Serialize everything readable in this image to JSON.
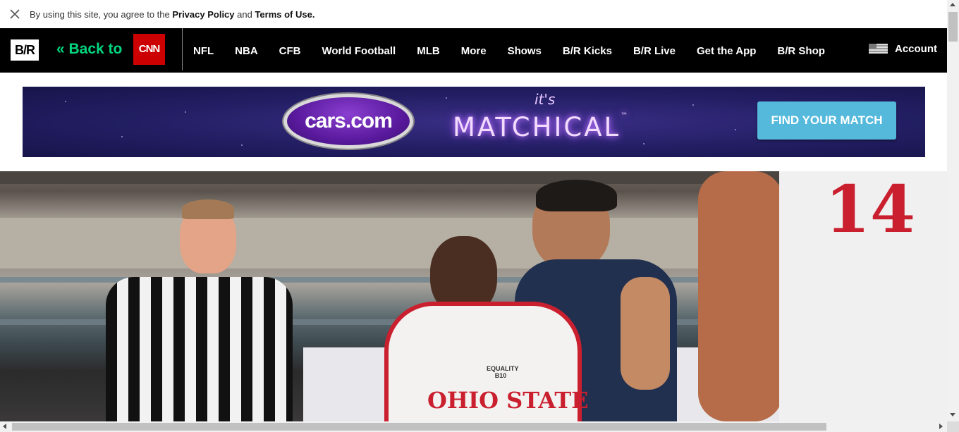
{
  "cookie_banner": {
    "prefix": "By using this site, you agree to the ",
    "privacy_link": "Privacy Policy",
    "and_text": " and ",
    "terms_link": "Terms of Use."
  },
  "nav": {
    "logo": "B/R",
    "back_to": "« Back to",
    "cnn_logo": "CNN",
    "items": [
      "NFL",
      "NBA",
      "CFB",
      "World Football",
      "MLB",
      "More",
      "Shows",
      "B/R Kicks",
      "B/R Live",
      "Get the App",
      "B/R Shop"
    ],
    "account": "Account"
  },
  "ad": {
    "brand": "cars.com",
    "tagline_small": "it's",
    "tagline_large": "MATCHICAL",
    "tm": "™",
    "cta": "FIND YOUR MATCH"
  },
  "hero": {
    "jersey_number": "14",
    "jersey_text": "OHIO STATE",
    "patch_text": "EQUALITY B10"
  },
  "colors": {
    "nav_bg": "#000000",
    "back_to": "#00d67e",
    "cnn_red": "#cc0000",
    "ad_bg": "#231e63",
    "cta_bg": "#55b9dc"
  }
}
